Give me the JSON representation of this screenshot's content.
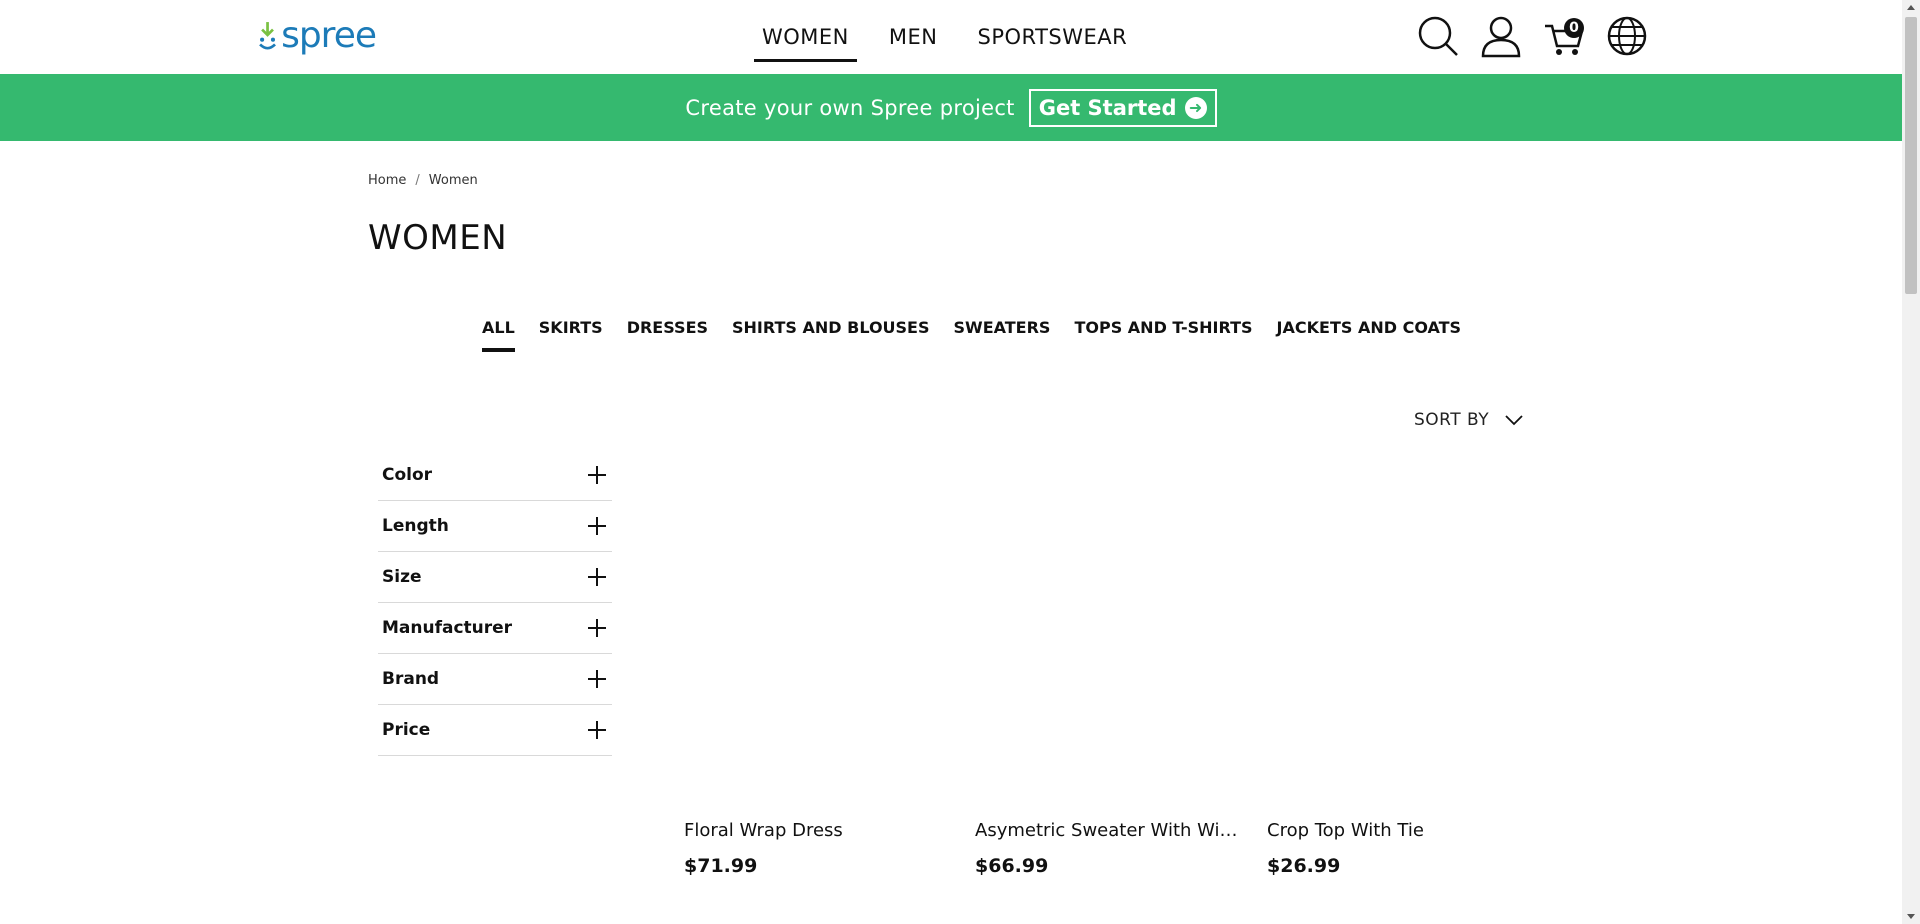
{
  "brand": {
    "name": "spree",
    "logo_color": "#1c7bb8",
    "accent_green": "#7ac142"
  },
  "main_nav": [
    {
      "label": "WOMEN",
      "active": true
    },
    {
      "label": "MEN",
      "active": false
    },
    {
      "label": "SPORTSWEAR",
      "active": false
    }
  ],
  "header_icons": {
    "search": "search-icon",
    "account": "user-icon",
    "cart": "cart-icon",
    "cart_count": "0",
    "locale": "globe-icon"
  },
  "banner": {
    "text": "Create your own Spree project",
    "button_label": "Get Started",
    "background": "#35b96f"
  },
  "breadcrumb": [
    {
      "label": "Home"
    },
    {
      "label": "Women"
    }
  ],
  "breadcrumb_separator": "/",
  "page_title": "WOMEN",
  "taxons": [
    {
      "label": "ALL",
      "active": true
    },
    {
      "label": "SKIRTS",
      "active": false
    },
    {
      "label": "DRESSES",
      "active": false
    },
    {
      "label": "SHIRTS AND BLOUSES",
      "active": false
    },
    {
      "label": "SWEATERS",
      "active": false
    },
    {
      "label": "TOPS AND T-SHIRTS",
      "active": false
    },
    {
      "label": "JACKETS AND COATS",
      "active": false
    }
  ],
  "sort_by_label": "SORT BY",
  "filters": [
    {
      "label": "Color"
    },
    {
      "label": "Length"
    },
    {
      "label": "Size"
    },
    {
      "label": "Manufacturer"
    },
    {
      "label": "Brand"
    },
    {
      "label": "Price"
    }
  ],
  "products": [
    {
      "name": "Floral Wrap Dress",
      "price": "$71.99"
    },
    {
      "name": "Asymetric Sweater With Wide Sleeves",
      "price": "$66.99"
    },
    {
      "name": "Crop Top With Tie",
      "price": "$26.99"
    }
  ]
}
